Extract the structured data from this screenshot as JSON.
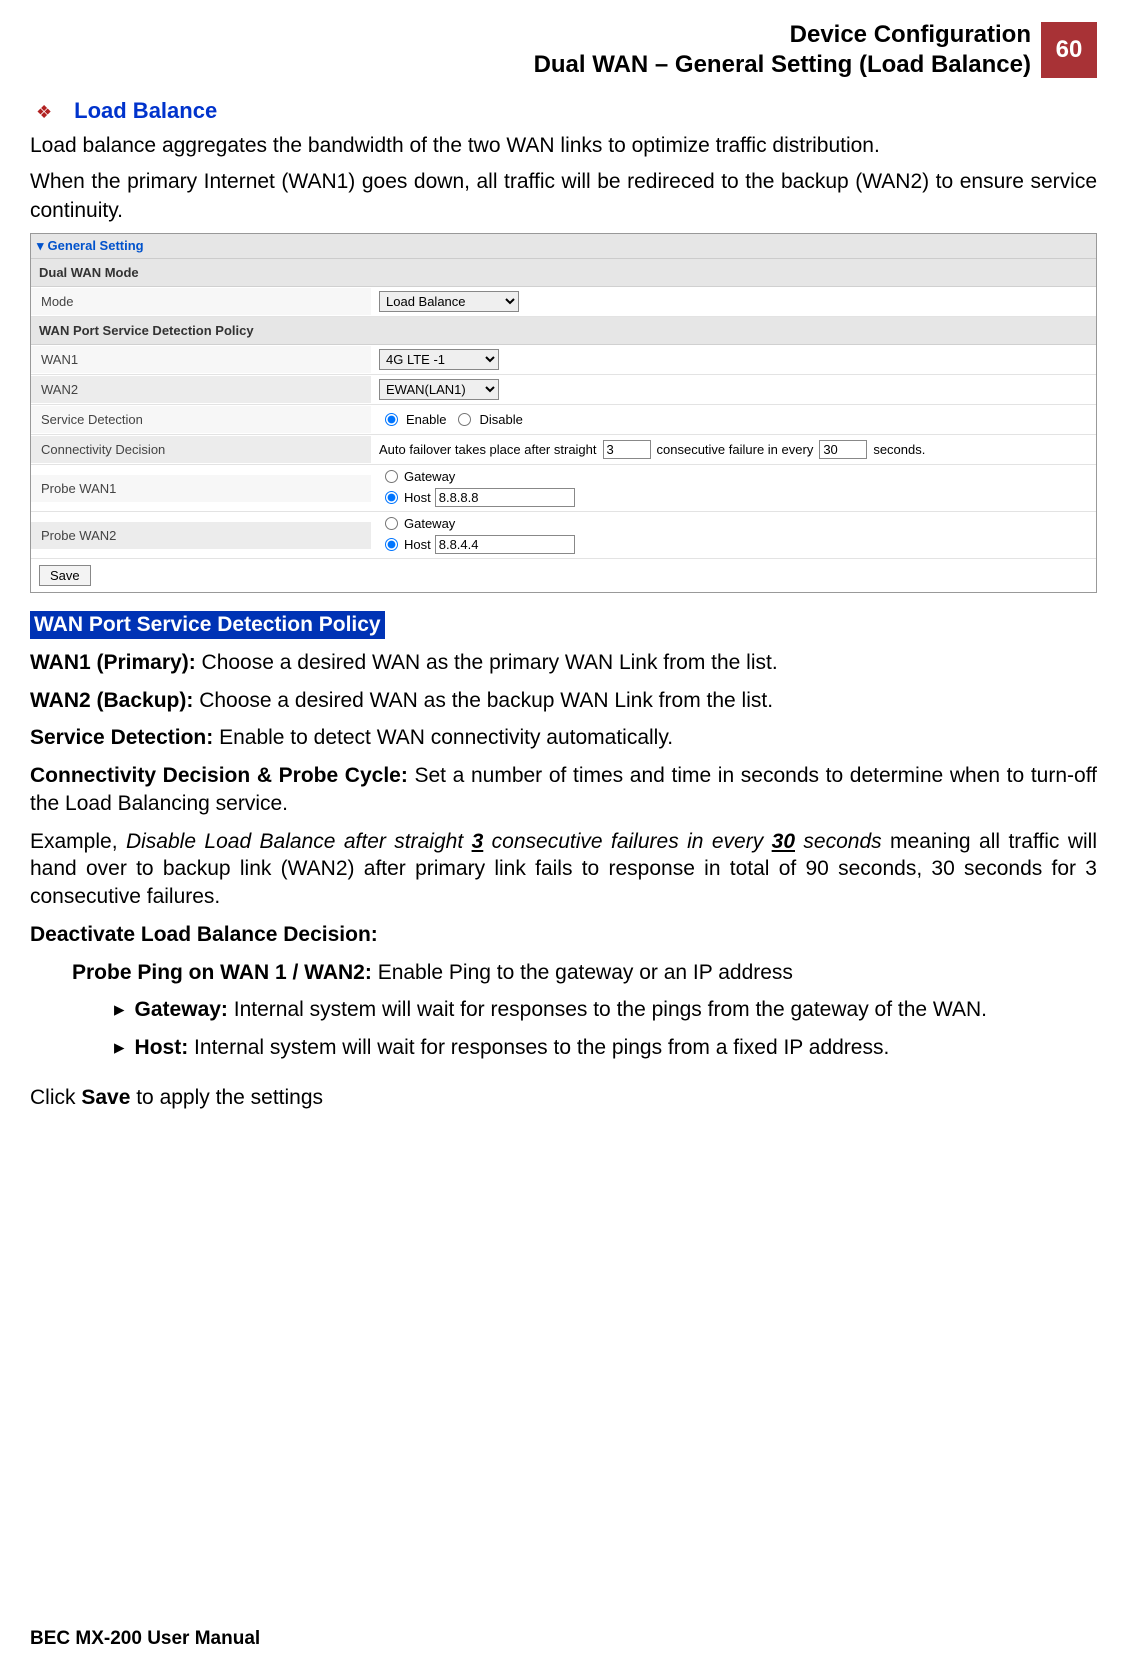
{
  "header": {
    "line1": "Device Configuration",
    "line2": "Dual WAN – General Setting (Load Balance)",
    "page_number": "60"
  },
  "section": {
    "title": "Load Balance",
    "para1": "Load balance aggregates the bandwidth of the two WAN links to optimize traffic distribution.",
    "para2": "When the primary Internet (WAN1) goes down, all traffic will be redireced to the backup (WAN2) to ensure service continuity."
  },
  "screenshot": {
    "panel_title": "General Setting",
    "group1": "Dual WAN Mode",
    "mode_label": "Mode",
    "mode_value": "Load Balance",
    "group2": "WAN Port Service Detection Policy",
    "wan1_label": "WAN1",
    "wan1_value": "4G LTE -1",
    "wan2_label": "WAN2",
    "wan2_value": "EWAN(LAN1)",
    "service_detection_label": "Service Detection",
    "enable_label": "Enable",
    "disable_label": "Disable",
    "connectivity_label": "Connectivity Decision",
    "connectivity_prefix": "Auto failover takes place after straight",
    "connectivity_count": "3",
    "connectivity_mid": "consecutive failure in every",
    "connectivity_seconds": "30",
    "connectivity_suffix": "seconds.",
    "probe_wan1_label": "Probe WAN1",
    "probe_wan2_label": "Probe WAN2",
    "gateway_label": "Gateway",
    "host_label": "Host",
    "host1_value": "8.8.8.8",
    "host2_value": "8.8.4.4",
    "save_label": "Save"
  },
  "explain": {
    "heading": "WAN Port Service Detection Policy",
    "wan1_bold": "WAN1 (Primary):",
    "wan1_text": " Choose a desired WAN as the primary WAN Link from the list.",
    "wan2_bold": "WAN2 (Backup):",
    "wan2_text": " Choose a desired WAN as the backup WAN Link from the list.",
    "sd_bold": "Service Detection:",
    "sd_text": " Enable to detect WAN connectivity automatically.",
    "cd_bold": "Connectivity Decision & Probe Cycle:",
    "cd_text": " Set a number of times and time in seconds to determine when to turn-off the Load Balancing service.",
    "example_prefix": "Example, ",
    "example_italic1": "Disable Load Balance after straight ",
    "example_bold_u1": "3",
    "example_italic2": " consecutive failures in every ",
    "example_bold_u2": "30",
    "example_italic3": " seconds",
    "example_rest": " meaning all traffic will hand over to backup link (WAN2) after primary link fails to response in total of 90 seconds, 30 seconds for 3 consecutive failures.",
    "deact_bold": "Deactivate Load Balance Decision:",
    "probe_bold": "Probe Ping on WAN 1 / WAN2:",
    "probe_text": " Enable Ping to the gateway or an IP address",
    "gw_bold": "Gateway:",
    "gw_text": " Internal system will wait for responses to the pings from the gateway of the WAN.",
    "host_bold": "Host:",
    "host_text": " Internal system will wait for responses to the pings from a fixed IP address.",
    "click_prefix": "Click ",
    "click_bold": "Save",
    "click_suffix": " to apply the settings"
  },
  "footer": {
    "text": "BEC MX-200 User Manual"
  }
}
